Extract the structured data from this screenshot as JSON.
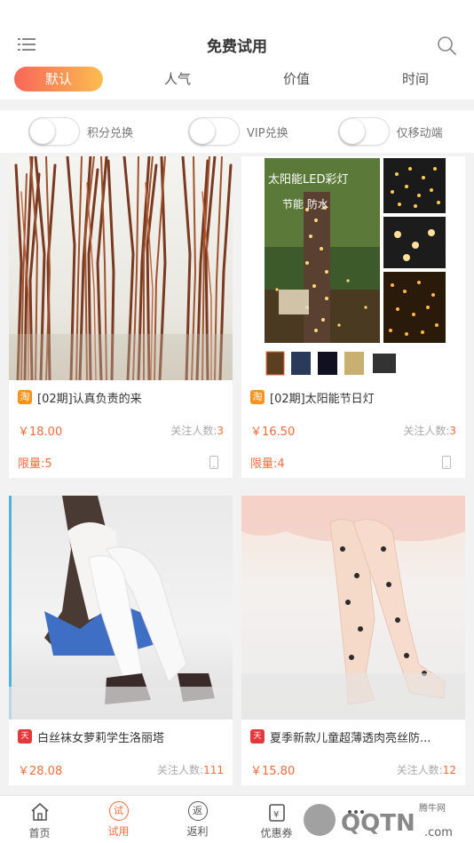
{
  "header": {
    "title": "免费试用",
    "menu_icon": "list-icon",
    "search_icon": "search-icon"
  },
  "tabs": [
    {
      "label": "默认",
      "active": true
    },
    {
      "label": "人气",
      "active": false
    },
    {
      "label": "价值",
      "active": false
    },
    {
      "label": "时间",
      "active": false
    }
  ],
  "filters": [
    {
      "label": "积分兑换",
      "on": false
    },
    {
      "label": "VIP兑换",
      "on": false
    },
    {
      "label": "仅移动端",
      "on": false
    }
  ],
  "products": [
    {
      "badge": "淘",
      "name": "[02期]认真负责的来",
      "price": "￥18.00",
      "follow_label": "关注人数:",
      "follow_count": "3",
      "limit": "限量:5"
    },
    {
      "badge": "淘",
      "name": "[02期]太阳能节日灯",
      "price": "￥16.50",
      "follow_label": "关注人数:",
      "follow_count": "3",
      "limit": "限量:4",
      "image_text": "太阳能LED彩灯 节能 防水"
    },
    {
      "badge": "天猫",
      "name": "白丝袜女萝莉学生洛丽塔",
      "price": "￥28.08",
      "follow_label": "关注人数:",
      "follow_count": "111"
    },
    {
      "badge": "天猫",
      "name": "夏季新款儿童超薄透肉亮丝防...",
      "price": "￥15.80",
      "follow_label": "关注人数:",
      "follow_count": "12"
    }
  ],
  "tabbar": [
    {
      "label": "首页",
      "icon": "home-icon"
    },
    {
      "label": "试用",
      "icon": "试",
      "active": true
    },
    {
      "label": "返利",
      "icon": "返"
    },
    {
      "label": "优惠券",
      "icon": "coupon-icon"
    },
    {
      "label": "",
      "icon": "more-icon"
    }
  ],
  "watermark": {
    "brand": "QQTN",
    "sub": "腾牛网"
  },
  "colors": {
    "accent": "#f36c3c",
    "gradient_start": "#f9665a",
    "gradient_end": "#fbbd4f"
  }
}
